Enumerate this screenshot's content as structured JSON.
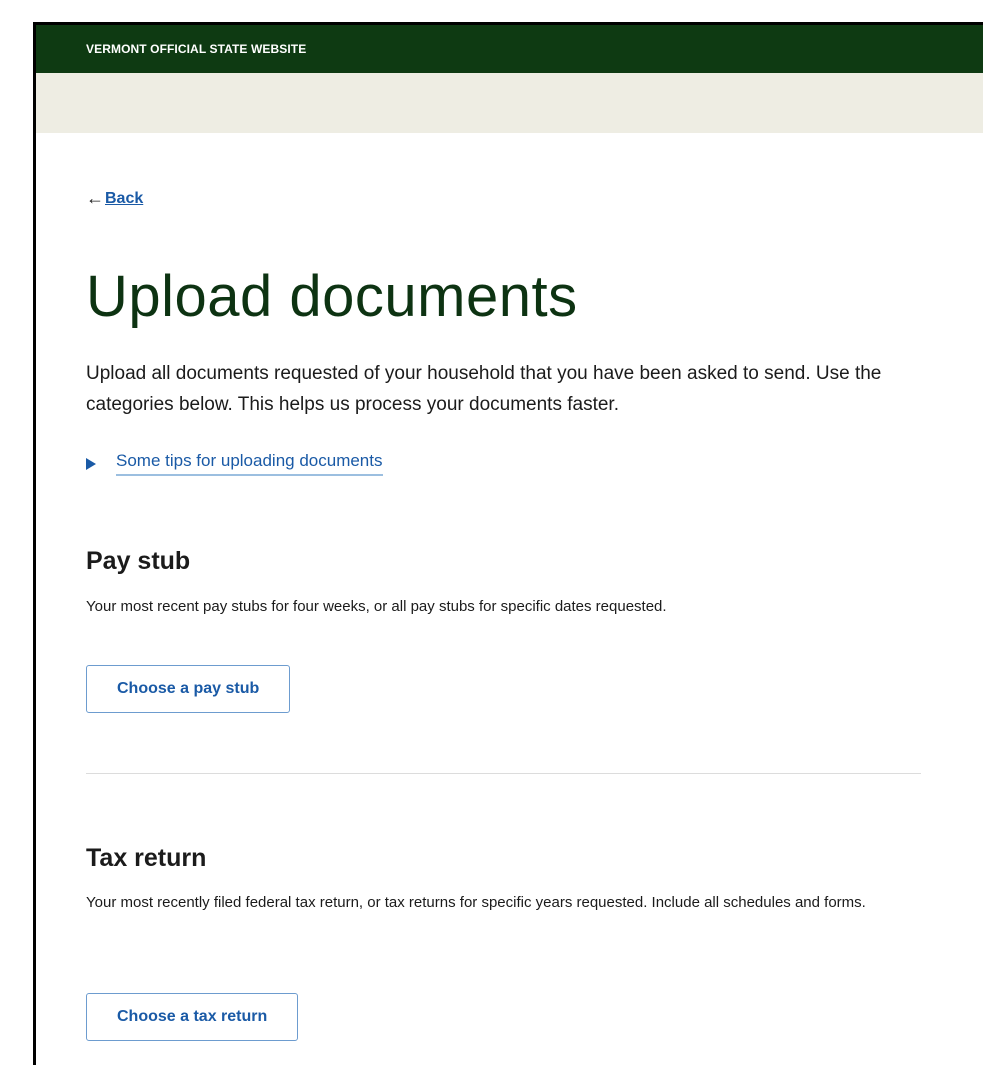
{
  "banner": {
    "text": "VERMONT OFFICIAL STATE WEBSITE"
  },
  "nav": {
    "back_arrow": "←",
    "back_label": "Back"
  },
  "page": {
    "title": "Upload documents",
    "intro": "Upload all documents requested of your household that you have been asked to send. Use the categories below. This helps us process your documents faster.",
    "tips_label": "Some tips for uploading documents"
  },
  "sections": [
    {
      "heading": "Pay stub",
      "description": "Your most recent pay stubs for four weeks, or all pay stubs for specific dates requested.",
      "button_label": "Choose a pay stub"
    },
    {
      "heading": "Tax return",
      "description": "Your most recently filed federal tax return, or tax returns for specific years requested. Include all schedules and forms.",
      "button_label": "Choose a tax return"
    }
  ],
  "colors": {
    "banner": "#0e3a12",
    "sub_header": "#eeede3",
    "title": "#0d3312",
    "link": "#1a5aa6"
  },
  "icons": {
    "tips_toggle": "caret-right-icon",
    "back": "arrow-left-icon"
  }
}
